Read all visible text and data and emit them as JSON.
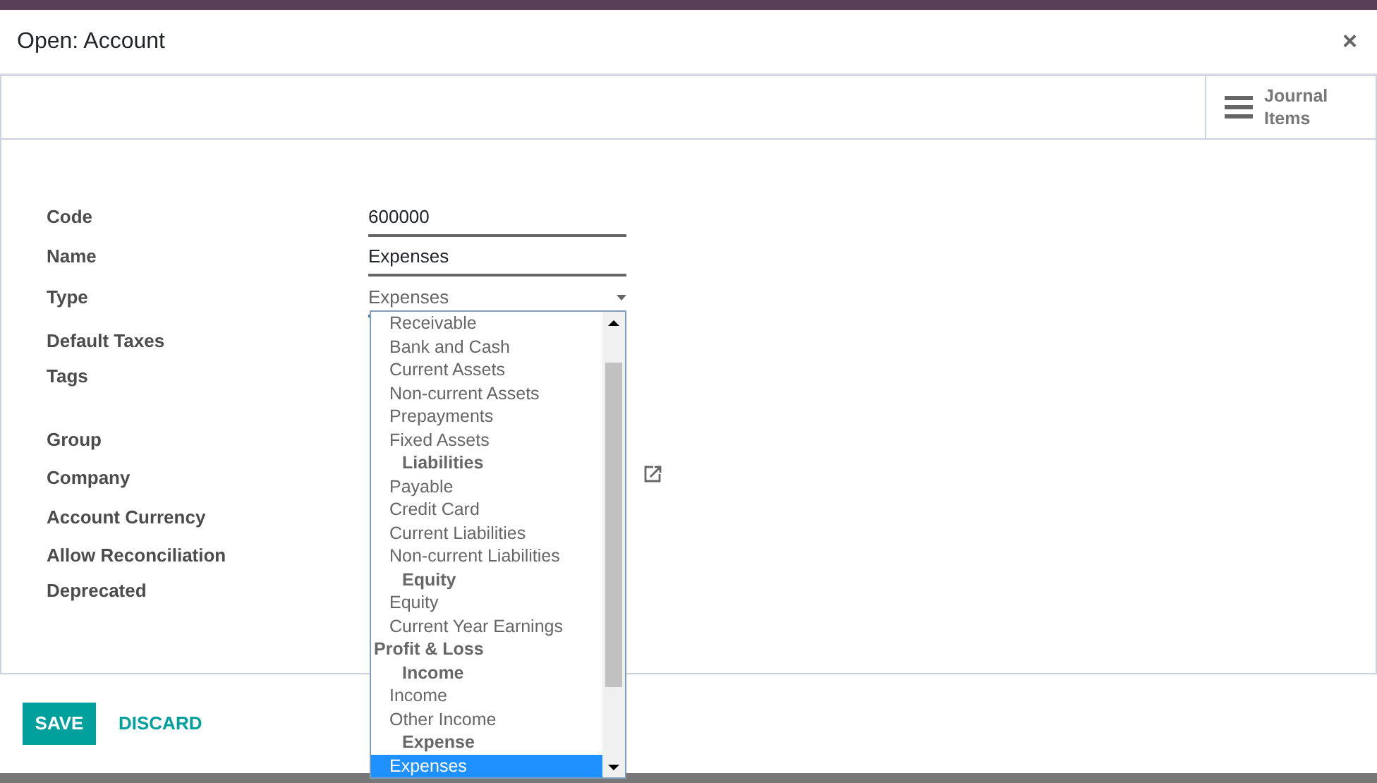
{
  "dialog": {
    "title": "Open: Account",
    "close": "×"
  },
  "button_box": {
    "label": "Journal Items"
  },
  "fields": [
    {
      "label": "Code",
      "kind": "input",
      "value": "600000"
    },
    {
      "label": "Name",
      "kind": "input",
      "value": "Expenses"
    },
    {
      "label": "Type",
      "kind": "select",
      "value": "Expenses"
    },
    {
      "label": "Default Taxes",
      "kind": "empty"
    },
    {
      "label": "Tags",
      "kind": "empty"
    },
    {
      "label": "Group",
      "kind": "empty"
    },
    {
      "label": "Company",
      "kind": "link"
    },
    {
      "label": "Account Currency",
      "kind": "empty"
    },
    {
      "label": "Allow Reconciliation",
      "kind": "empty"
    },
    {
      "label": "Deprecated",
      "kind": "empty"
    }
  ],
  "dropdown_options": [
    {
      "label": "Receivable",
      "kind": "option",
      "selected": false
    },
    {
      "label": "Bank and Cash",
      "kind": "option",
      "selected": false
    },
    {
      "label": "Current Assets",
      "kind": "option",
      "selected": false
    },
    {
      "label": "Non-current Assets",
      "kind": "option",
      "selected": false
    },
    {
      "label": "Prepayments",
      "kind": "option",
      "selected": false
    },
    {
      "label": "Fixed Assets",
      "kind": "option",
      "selected": false
    },
    {
      "label": "Liabilities",
      "kind": "group",
      "selected": false
    },
    {
      "label": "Payable",
      "kind": "option",
      "selected": false
    },
    {
      "label": "Credit Card",
      "kind": "option",
      "selected": false
    },
    {
      "label": "Current Liabilities",
      "kind": "option",
      "selected": false
    },
    {
      "label": "Non-current Liabilities",
      "kind": "option",
      "selected": false
    },
    {
      "label": "Equity",
      "kind": "group",
      "selected": false
    },
    {
      "label": "Equity",
      "kind": "option",
      "selected": false
    },
    {
      "label": "Current Year Earnings",
      "kind": "option",
      "selected": false
    },
    {
      "label": "Profit & Loss",
      "kind": "section",
      "selected": false
    },
    {
      "label": "Income",
      "kind": "group",
      "selected": false
    },
    {
      "label": "Income",
      "kind": "option",
      "selected": false
    },
    {
      "label": "Other Income",
      "kind": "option",
      "selected": false
    },
    {
      "label": "Expense",
      "kind": "group",
      "selected": false
    },
    {
      "label": "Expenses",
      "kind": "option",
      "selected": true
    }
  ],
  "footer": {
    "save": "SAVE",
    "discard": "DISCARD"
  }
}
